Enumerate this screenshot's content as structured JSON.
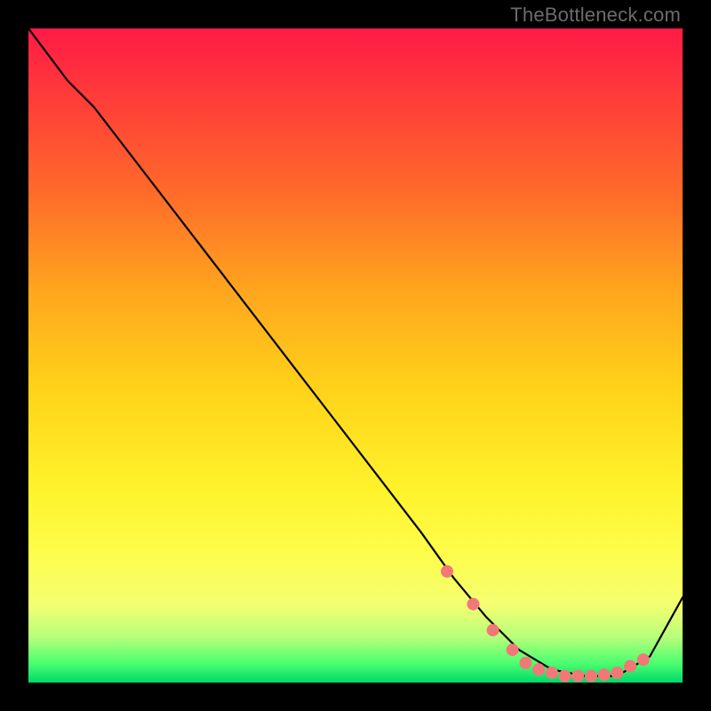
{
  "watermark": "TheBottleneck.com",
  "chart_data": {
    "type": "line",
    "title": "",
    "xlabel": "",
    "ylabel": "",
    "xlim": [
      0,
      100
    ],
    "ylim": [
      0,
      100
    ],
    "series": [
      {
        "name": "curve",
        "x": [
          0,
          6,
          10,
          20,
          30,
          40,
          50,
          60,
          65,
          70,
          75,
          80,
          85,
          90,
          95,
          100
        ],
        "y": [
          100,
          92,
          88,
          75,
          62,
          49,
          36,
          23,
          16,
          10,
          5,
          2,
          1,
          1,
          4,
          13
        ]
      }
    ],
    "markers": {
      "name": "dots",
      "color": "#f27878",
      "x": [
        64,
        68,
        71,
        74,
        76,
        78,
        80,
        82,
        84,
        86,
        88,
        90,
        92,
        94
      ],
      "y": [
        17,
        12,
        8,
        5,
        3,
        2,
        1.5,
        1,
        1,
        1,
        1.2,
        1.5,
        2.5,
        3.5
      ]
    }
  }
}
